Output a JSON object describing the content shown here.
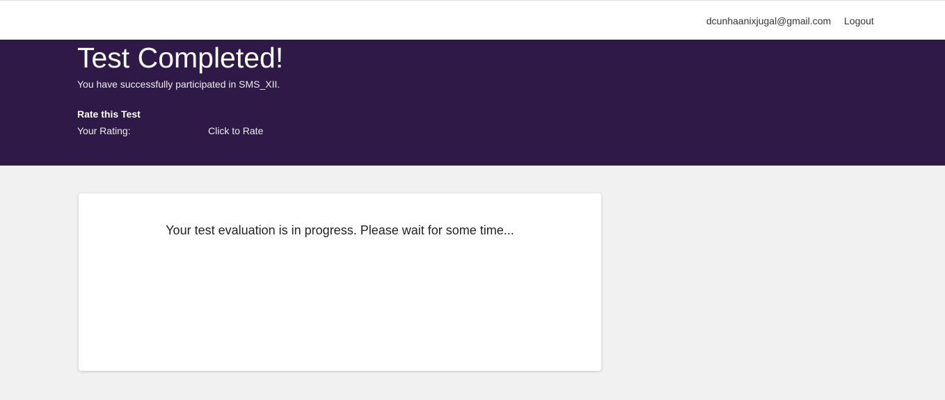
{
  "header": {
    "user_email": "dcunhaanixjugal@gmail.com",
    "logout_label": "Logout"
  },
  "hero": {
    "title": "Test Completed!",
    "subtitle": "You have successfully participated in SMS_XII.",
    "rate_heading": "Rate this Test",
    "rating_label": "Your Rating:",
    "rate_action": "Click to Rate"
  },
  "main": {
    "status_message": "Your test evaluation is in progress. Please wait for some time..."
  },
  "colors": {
    "hero_background": "#2f1946",
    "page_background": "#f1f1f1",
    "card_background": "#ffffff"
  }
}
